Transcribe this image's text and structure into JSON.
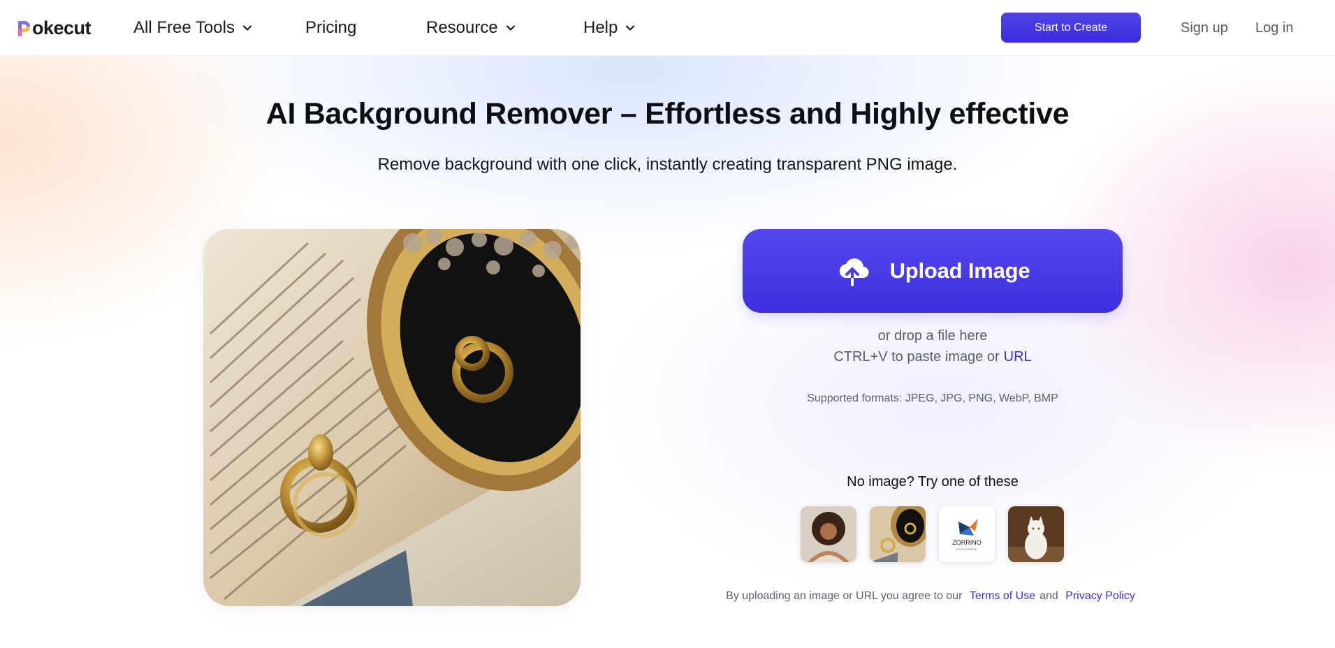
{
  "header": {
    "brand": "okecut",
    "nav": [
      {
        "label": "All Free Tools",
        "dropdown": true
      },
      {
        "label": "Pricing",
        "dropdown": false
      },
      {
        "label": "Resource",
        "dropdown": true
      },
      {
        "label": "Help",
        "dropdown": true
      }
    ],
    "cta_label": "Start to Create",
    "signup_label": "Sign up",
    "login_label": "Log in"
  },
  "hero": {
    "title": "AI Background Remover – Effortless and Highly effective",
    "subtitle": "Remove background with one click, instantly creating transparent PNG image."
  },
  "upload": {
    "button_label": "Upload Image",
    "icon": "cloud-upload-icon",
    "drop_text": "or drop a file here",
    "paste_text": "CTRL+V to paste image or",
    "url_label": "URL",
    "formats": "Supported formats: JPEG, JPG, PNG, WebP, BMP"
  },
  "samples": {
    "title": "No image? Try one of these",
    "logo_text": "ZORRINO",
    "logo_subtext": "PHOTOGRAPHY"
  },
  "legal": {
    "prefix": "By uploading an image or URL you agree to our",
    "terms": "Terms of Use",
    "and": "and",
    "privacy": "Privacy Policy"
  },
  "colors": {
    "accent": "#4a3de6",
    "link": "#3b2fd6",
    "text": "#111111",
    "muted": "#5a5e6a"
  }
}
